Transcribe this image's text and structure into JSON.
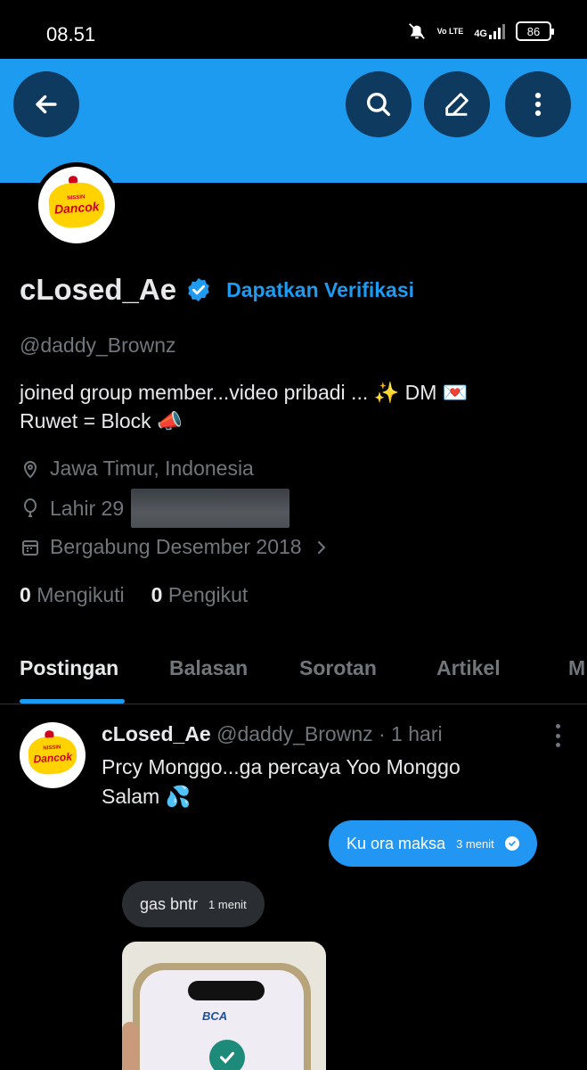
{
  "status_bar": {
    "time": "08.51",
    "network_volte": "Vo LTE",
    "network_type": "4G",
    "battery": "86"
  },
  "profile": {
    "display_name": "cLosed_Ae",
    "get_verified": "Dapatkan Verifikasi",
    "handle": "@daddy_Brownz",
    "bio_line1": "joined group member...video pribadi ... ✨ DM 💌",
    "bio_line2": "Ruwet = Block 📣",
    "location": "Jawa Timur, Indonesia",
    "birth": "Lahir 29",
    "joined": "Bergabung Desember 2018",
    "following_count": "0",
    "following_label": "Mengikuti",
    "followers_count": "0",
    "followers_label": "Pengikut",
    "avatar_logo_top": "NISSIN",
    "avatar_logo_name": "Dancok"
  },
  "tabs": [
    {
      "label": "Postingan",
      "active": true
    },
    {
      "label": "Balasan",
      "active": false
    },
    {
      "label": "Sorotan",
      "active": false
    },
    {
      "label": "Artikel",
      "active": false
    },
    {
      "label": "M",
      "active": false
    }
  ],
  "post": {
    "author": "cLosed_Ae",
    "handle": "@daddy_Brownz",
    "time": "· 1 hari",
    "text_line1": "Prcy Monggo...ga percaya Yoo Monggo",
    "text_line2": "Salam 💦",
    "chat_sent": {
      "message": "Ku ora maksa",
      "time": "3 menit"
    },
    "chat_received": {
      "message": "gas bntr",
      "time": "1 menit"
    },
    "photo_bank_label": "BCA"
  },
  "colors": {
    "accent": "#1d9bf0",
    "background": "#000000",
    "secondary_text": "#71767b"
  }
}
